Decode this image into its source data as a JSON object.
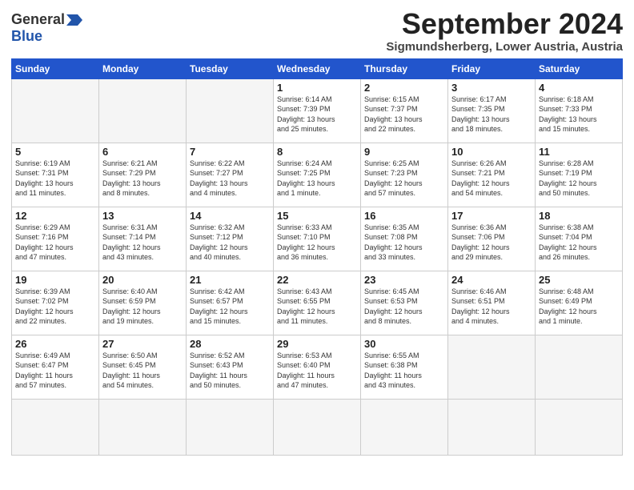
{
  "header": {
    "logo_general": "General",
    "logo_blue": "Blue",
    "month_title": "September 2024",
    "location": "Sigmundsherberg, Lower Austria, Austria"
  },
  "weekdays": [
    "Sunday",
    "Monday",
    "Tuesday",
    "Wednesday",
    "Thursday",
    "Friday",
    "Saturday"
  ],
  "days": [
    {
      "num": "",
      "info": ""
    },
    {
      "num": "",
      "info": ""
    },
    {
      "num": "",
      "info": ""
    },
    {
      "num": "1",
      "info": "Sunrise: 6:14 AM\nSunset: 7:39 PM\nDaylight: 13 hours\nand 25 minutes."
    },
    {
      "num": "2",
      "info": "Sunrise: 6:15 AM\nSunset: 7:37 PM\nDaylight: 13 hours\nand 22 minutes."
    },
    {
      "num": "3",
      "info": "Sunrise: 6:17 AM\nSunset: 7:35 PM\nDaylight: 13 hours\nand 18 minutes."
    },
    {
      "num": "4",
      "info": "Sunrise: 6:18 AM\nSunset: 7:33 PM\nDaylight: 13 hours\nand 15 minutes."
    },
    {
      "num": "5",
      "info": "Sunrise: 6:19 AM\nSunset: 7:31 PM\nDaylight: 13 hours\nand 11 minutes."
    },
    {
      "num": "6",
      "info": "Sunrise: 6:21 AM\nSunset: 7:29 PM\nDaylight: 13 hours\nand 8 minutes."
    },
    {
      "num": "7",
      "info": "Sunrise: 6:22 AM\nSunset: 7:27 PM\nDaylight: 13 hours\nand 4 minutes."
    },
    {
      "num": "8",
      "info": "Sunrise: 6:24 AM\nSunset: 7:25 PM\nDaylight: 13 hours\nand 1 minute."
    },
    {
      "num": "9",
      "info": "Sunrise: 6:25 AM\nSunset: 7:23 PM\nDaylight: 12 hours\nand 57 minutes."
    },
    {
      "num": "10",
      "info": "Sunrise: 6:26 AM\nSunset: 7:21 PM\nDaylight: 12 hours\nand 54 minutes."
    },
    {
      "num": "11",
      "info": "Sunrise: 6:28 AM\nSunset: 7:19 PM\nDaylight: 12 hours\nand 50 minutes."
    },
    {
      "num": "12",
      "info": "Sunrise: 6:29 AM\nSunset: 7:16 PM\nDaylight: 12 hours\nand 47 minutes."
    },
    {
      "num": "13",
      "info": "Sunrise: 6:31 AM\nSunset: 7:14 PM\nDaylight: 12 hours\nand 43 minutes."
    },
    {
      "num": "14",
      "info": "Sunrise: 6:32 AM\nSunset: 7:12 PM\nDaylight: 12 hours\nand 40 minutes."
    },
    {
      "num": "15",
      "info": "Sunrise: 6:33 AM\nSunset: 7:10 PM\nDaylight: 12 hours\nand 36 minutes."
    },
    {
      "num": "16",
      "info": "Sunrise: 6:35 AM\nSunset: 7:08 PM\nDaylight: 12 hours\nand 33 minutes."
    },
    {
      "num": "17",
      "info": "Sunrise: 6:36 AM\nSunset: 7:06 PM\nDaylight: 12 hours\nand 29 minutes."
    },
    {
      "num": "18",
      "info": "Sunrise: 6:38 AM\nSunset: 7:04 PM\nDaylight: 12 hours\nand 26 minutes."
    },
    {
      "num": "19",
      "info": "Sunrise: 6:39 AM\nSunset: 7:02 PM\nDaylight: 12 hours\nand 22 minutes."
    },
    {
      "num": "20",
      "info": "Sunrise: 6:40 AM\nSunset: 6:59 PM\nDaylight: 12 hours\nand 19 minutes."
    },
    {
      "num": "21",
      "info": "Sunrise: 6:42 AM\nSunset: 6:57 PM\nDaylight: 12 hours\nand 15 minutes."
    },
    {
      "num": "22",
      "info": "Sunrise: 6:43 AM\nSunset: 6:55 PM\nDaylight: 12 hours\nand 11 minutes."
    },
    {
      "num": "23",
      "info": "Sunrise: 6:45 AM\nSunset: 6:53 PM\nDaylight: 12 hours\nand 8 minutes."
    },
    {
      "num": "24",
      "info": "Sunrise: 6:46 AM\nSunset: 6:51 PM\nDaylight: 12 hours\nand 4 minutes."
    },
    {
      "num": "25",
      "info": "Sunrise: 6:48 AM\nSunset: 6:49 PM\nDaylight: 12 hours\nand 1 minute."
    },
    {
      "num": "26",
      "info": "Sunrise: 6:49 AM\nSunset: 6:47 PM\nDaylight: 11 hours\nand 57 minutes."
    },
    {
      "num": "27",
      "info": "Sunrise: 6:50 AM\nSunset: 6:45 PM\nDaylight: 11 hours\nand 54 minutes."
    },
    {
      "num": "28",
      "info": "Sunrise: 6:52 AM\nSunset: 6:43 PM\nDaylight: 11 hours\nand 50 minutes."
    },
    {
      "num": "29",
      "info": "Sunrise: 6:53 AM\nSunset: 6:40 PM\nDaylight: 11 hours\nand 47 minutes."
    },
    {
      "num": "30",
      "info": "Sunrise: 6:55 AM\nSunset: 6:38 PM\nDaylight: 11 hours\nand 43 minutes."
    },
    {
      "num": "",
      "info": ""
    },
    {
      "num": "",
      "info": ""
    },
    {
      "num": "",
      "info": ""
    },
    {
      "num": "",
      "info": ""
    },
    {
      "num": "",
      "info": ""
    }
  ]
}
